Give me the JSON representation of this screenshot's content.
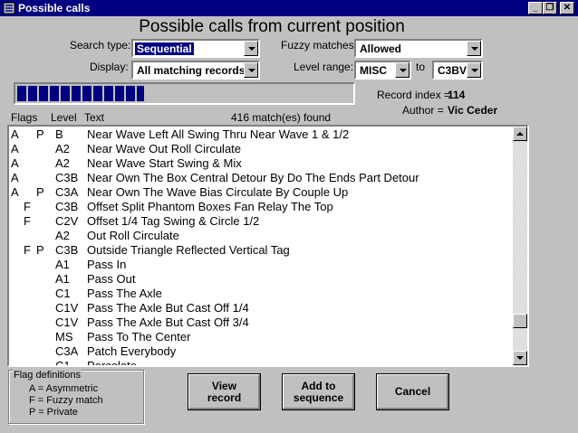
{
  "window": {
    "title": "Possible calls",
    "minimize": "_",
    "restore": "❐",
    "close": "✕"
  },
  "heading": "Possible calls from current position",
  "search_type": {
    "label": "Search type:",
    "value": "Sequential"
  },
  "fuzzy": {
    "label": "Fuzzy matches:",
    "value": "Allowed"
  },
  "display": {
    "label": "Display:",
    "value": "All matching records"
  },
  "level_range": {
    "label": "Level range:",
    "from": "MISC",
    "to_label": "to",
    "to": "C3BV"
  },
  "progress": {
    "fraction": 0.38
  },
  "record_index": {
    "label": "Record index =",
    "value": "114"
  },
  "author": {
    "label": "Author =",
    "value": "Vic Ceder"
  },
  "columns": {
    "flags": "Flags",
    "level": "Level",
    "text": "Text",
    "match_count": "416  match(es) found"
  },
  "rows": [
    {
      "f1": "A",
      "f2": "",
      "f3": "P",
      "level": "B",
      "text": "Near Wave Left All Swing Thru Near Wave 1 & 1/2"
    },
    {
      "f1": "A",
      "f2": "",
      "f3": "",
      "level": "A2",
      "text": "Near Wave Out Roll Circulate"
    },
    {
      "f1": "A",
      "f2": "",
      "f3": "",
      "level": "A2",
      "text": "Near Wave Start Swing & Mix"
    },
    {
      "f1": "A",
      "f2": "",
      "f3": "",
      "level": "C3B",
      "text": "Near Own The Box Central Detour By Do The Ends Part Detour"
    },
    {
      "f1": "A",
      "f2": "",
      "f3": "P",
      "level": "C3A",
      "text": "Near Own The Wave Bias Circulate By Couple Up"
    },
    {
      "f1": "",
      "f2": "F",
      "f3": "",
      "level": "C3B",
      "text": "Offset Split Phantom Boxes Fan Relay The Top"
    },
    {
      "f1": "",
      "f2": "F",
      "f3": "",
      "level": "C2V",
      "text": "Offset 1/4 Tag Swing & Circle 1/2"
    },
    {
      "f1": "",
      "f2": "",
      "f3": "",
      "level": "A2",
      "text": "Out Roll Circulate"
    },
    {
      "f1": "",
      "f2": "F",
      "f3": "P",
      "level": "C3B",
      "text": "Outside Triangle Reflected Vertical Tag"
    },
    {
      "f1": "",
      "f2": "",
      "f3": "",
      "level": "A1",
      "text": "Pass In"
    },
    {
      "f1": "",
      "f2": "",
      "f3": "",
      "level": "A1",
      "text": "Pass Out"
    },
    {
      "f1": "",
      "f2": "",
      "f3": "",
      "level": "C1",
      "text": "Pass The Axle"
    },
    {
      "f1": "",
      "f2": "",
      "f3": "",
      "level": "C1V",
      "text": "Pass The Axle But Cast Off 1/4"
    },
    {
      "f1": "",
      "f2": "",
      "f3": "",
      "level": "C1V",
      "text": "Pass The Axle But Cast Off 3/4"
    },
    {
      "f1": "",
      "f2": "",
      "f3": "",
      "level": "MS",
      "text": "Pass To The Center"
    },
    {
      "f1": "",
      "f2": "",
      "f3": "",
      "level": "C3A",
      "text": "Patch Everybody"
    },
    {
      "f1": "",
      "f2": "",
      "f3": "",
      "level": "C1",
      "text": "Percolate"
    }
  ],
  "flag_definitions": {
    "title": "Flag definitions",
    "items": [
      "A = Asymmetric",
      "F = Fuzzy match",
      "P = Private"
    ]
  },
  "buttons": {
    "view": [
      "View",
      "record"
    ],
    "add": [
      "Add to",
      "sequence"
    ],
    "cancel": "Cancel"
  },
  "colors": {
    "titlebar": "#000080",
    "face": "#c0c0c0",
    "selection": "#000080"
  }
}
